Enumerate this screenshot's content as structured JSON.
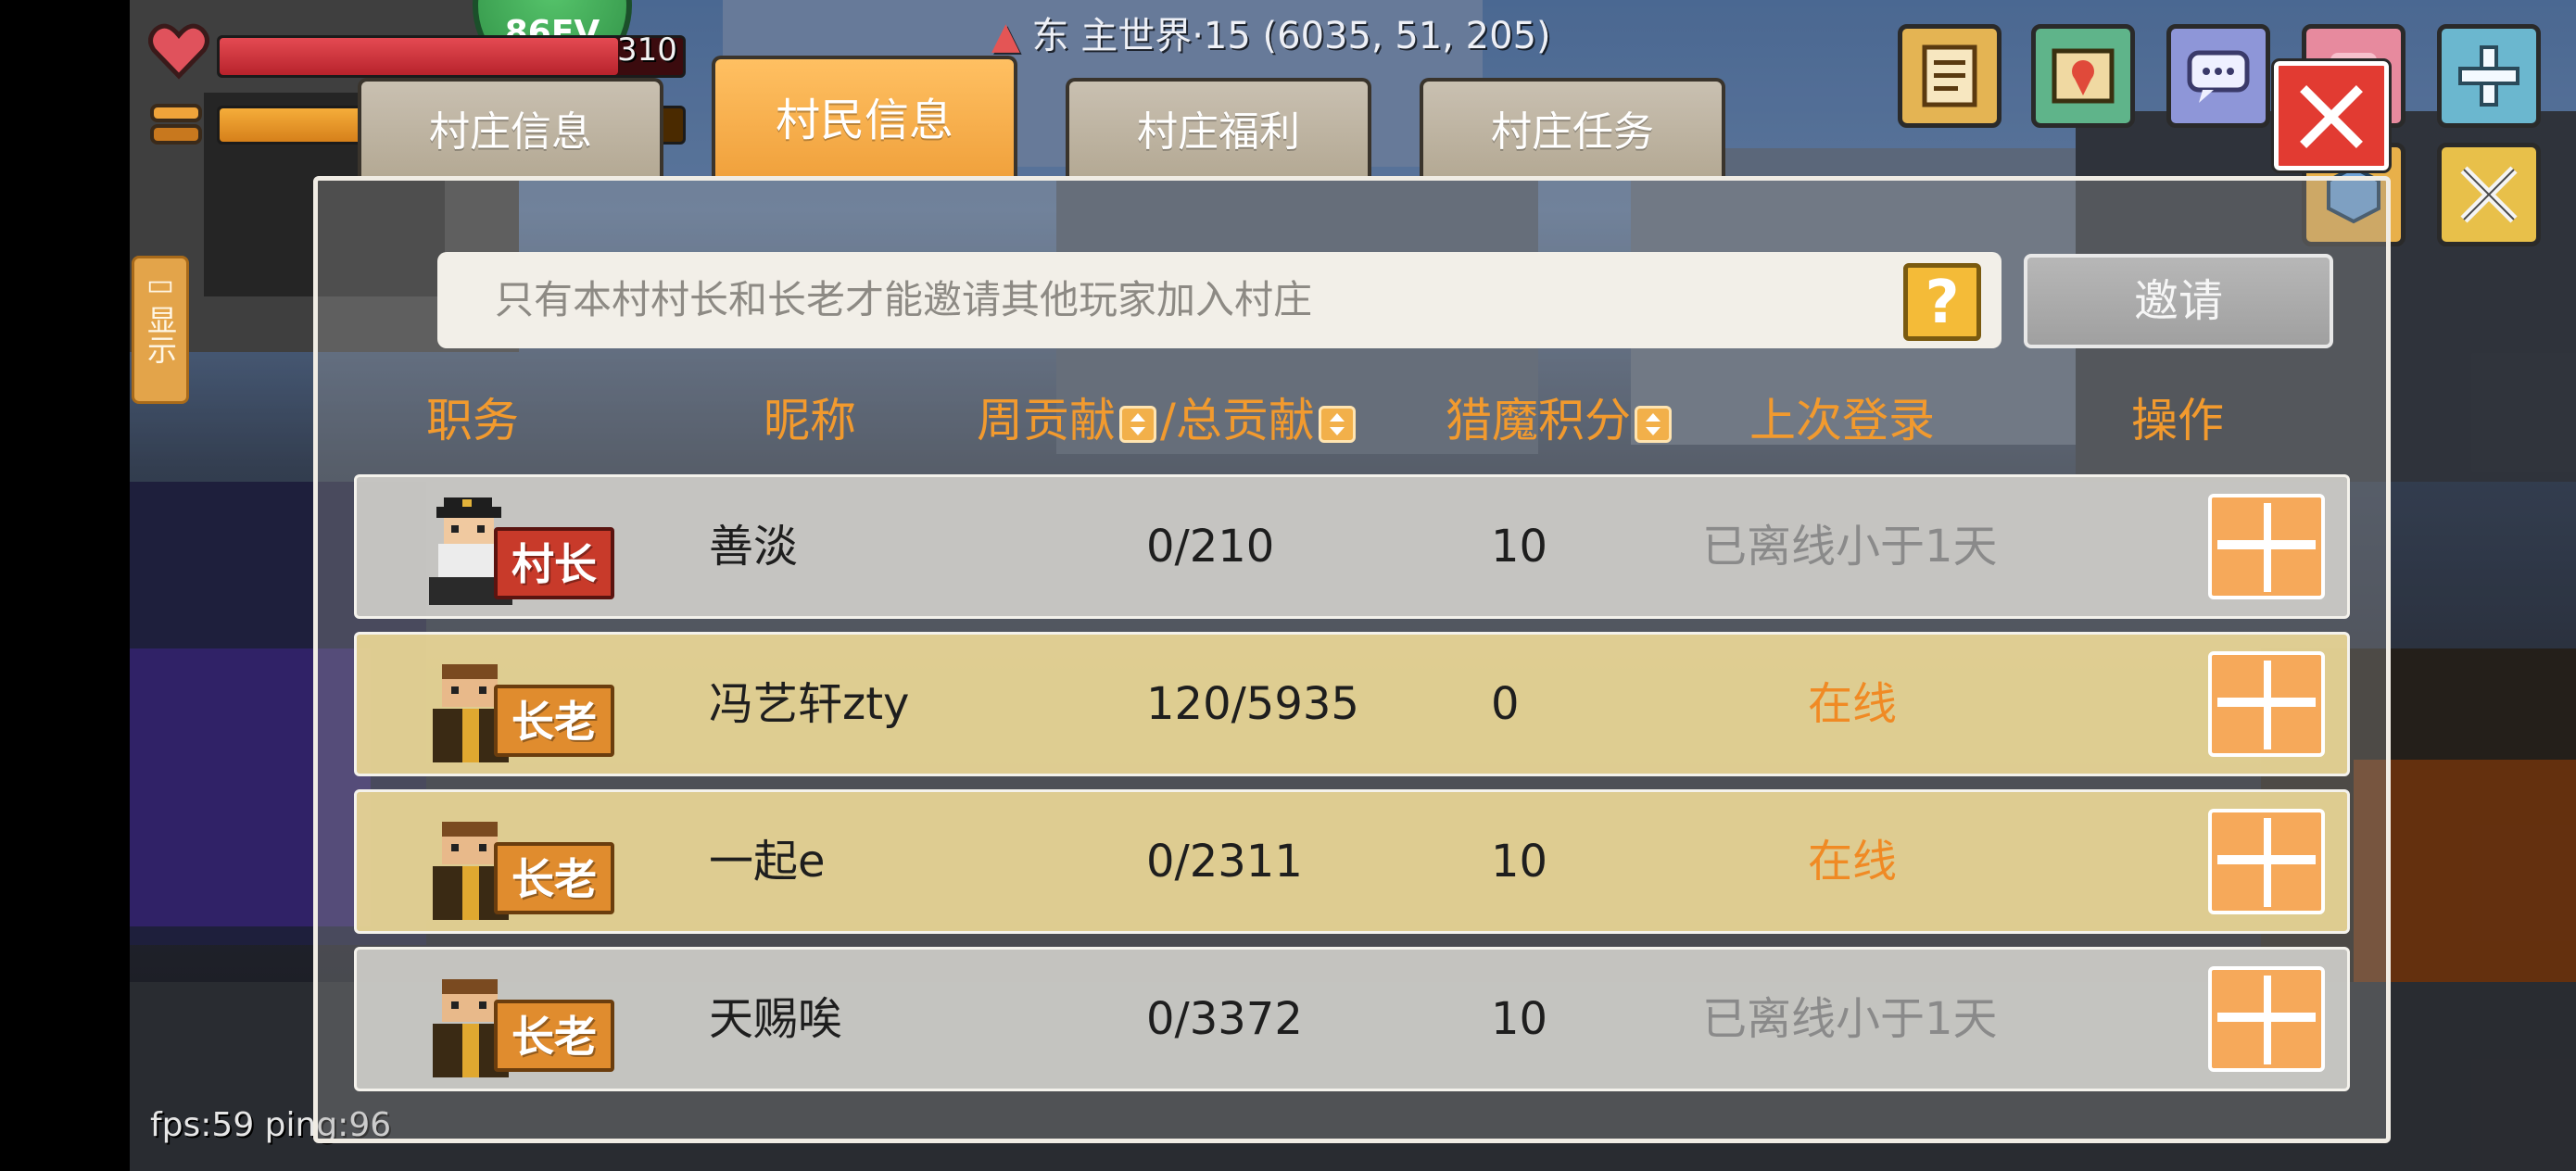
{
  "hud": {
    "hp_value": "310",
    "hp_fraction": 0.86,
    "hunger_fraction": 0.62,
    "green_ball_text": "86EV",
    "location": "东  主世界·15  (6035, 51, 205)",
    "side_tab_label": "显示",
    "fps_text": "fps:59 ping:96",
    "top_icons": [
      "scroll-icon",
      "map-icon",
      "chat-icon",
      "pink-icon",
      "plus-icon",
      "cube-icon",
      "crossed-swords-icon"
    ]
  },
  "tabs": [
    {
      "label": "村庄信息",
      "active": false
    },
    {
      "label": "村民信息",
      "active": true
    },
    {
      "label": "村庄福利",
      "active": false
    },
    {
      "label": "村庄任务",
      "active": false
    }
  ],
  "invite": {
    "placeholder": "只有本村村长和长老才能邀请其他玩家加入村庄",
    "help_label": "?",
    "button_label": "邀请"
  },
  "columns": {
    "role": "职务",
    "nickname": "昵称",
    "weekly": "周贡献",
    "sep": "/",
    "total": "总贡献",
    "points": "猎魔积分",
    "last_login": "上次登录",
    "action": "操作"
  },
  "members": [
    {
      "role": "村长",
      "name": "善淡",
      "contribution": "0/210",
      "points": "10",
      "last_login": "已离线小于1天",
      "online": false
    },
    {
      "role": "长老",
      "name": "冯艺轩zty",
      "contribution": "120/5935",
      "points": "0",
      "last_login": "在线",
      "online": true
    },
    {
      "role": "长老",
      "name": "一起e",
      "contribution": "0/2311",
      "points": "10",
      "last_login": "在线",
      "online": true
    },
    {
      "role": "长老",
      "name": "天赐唉",
      "contribution": "0/3372",
      "points": "10",
      "last_login": "已离线小于1天",
      "online": false
    }
  ],
  "colors": {
    "accent_orange": "#f29a2e",
    "active_tab": "#ffc062",
    "close_red": "#e23b32"
  }
}
